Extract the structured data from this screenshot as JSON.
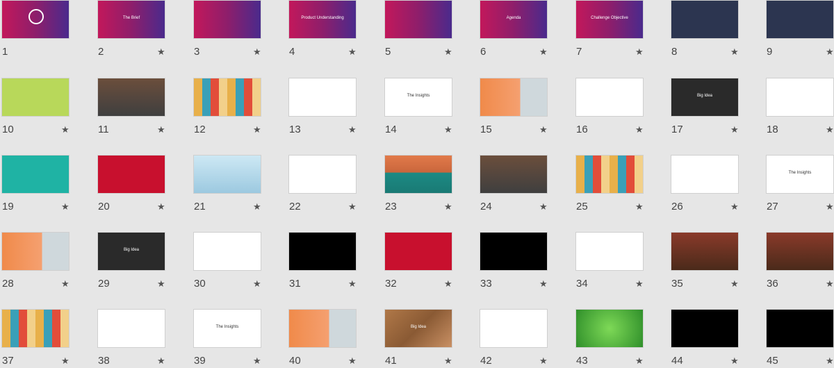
{
  "star_glyph": "★",
  "slides": [
    {
      "number": "1",
      "theme": "grad",
      "text": "",
      "starred": false
    },
    {
      "number": "2",
      "theme": "grad",
      "text": "The Brief",
      "starred": true
    },
    {
      "number": "3",
      "theme": "grad",
      "text": "",
      "starred": true
    },
    {
      "number": "4",
      "theme": "grad",
      "text": "Product Understanding",
      "starred": true
    },
    {
      "number": "5",
      "theme": "grad",
      "text": "",
      "starred": true
    },
    {
      "number": "6",
      "theme": "grad",
      "text": "Agenda",
      "starred": true
    },
    {
      "number": "7",
      "theme": "grad",
      "text": "Challenge     Objective",
      "starred": true
    },
    {
      "number": "8",
      "theme": "night",
      "text": "",
      "starred": true
    },
    {
      "number": "9",
      "theme": "night",
      "text": "",
      "starred": true
    },
    {
      "number": "10",
      "theme": "lime",
      "text": "",
      "starred": true
    },
    {
      "number": "11",
      "theme": "room",
      "text": "",
      "starred": true
    },
    {
      "number": "12",
      "theme": "pattern",
      "text": "",
      "starred": true
    },
    {
      "number": "13",
      "theme": "white",
      "text": "",
      "starred": true
    },
    {
      "number": "14",
      "theme": "white",
      "text": "The Insights",
      "starred": true
    },
    {
      "number": "15",
      "theme": "orange",
      "text": "",
      "starred": true
    },
    {
      "number": "16",
      "theme": "white",
      "text": "",
      "starred": true
    },
    {
      "number": "17",
      "theme": "dark",
      "text": "Big Idea",
      "starred": true
    },
    {
      "number": "18",
      "theme": "white",
      "text": "",
      "starred": true
    },
    {
      "number": "19",
      "theme": "teal",
      "text": "",
      "starred": true
    },
    {
      "number": "20",
      "theme": "red",
      "text": "",
      "starred": true
    },
    {
      "number": "21",
      "theme": "sky",
      "text": "",
      "starred": true
    },
    {
      "number": "22",
      "theme": "white",
      "text": "",
      "starred": true
    },
    {
      "number": "23",
      "theme": "kitchen",
      "text": "",
      "starred": true
    },
    {
      "number": "24",
      "theme": "room",
      "text": "",
      "starred": true
    },
    {
      "number": "25",
      "theme": "pattern",
      "text": "",
      "starred": true
    },
    {
      "number": "26",
      "theme": "white",
      "text": "",
      "starred": true
    },
    {
      "number": "27",
      "theme": "white",
      "text": "The Insights",
      "starred": true
    },
    {
      "number": "28",
      "theme": "orange",
      "text": "",
      "starred": true
    },
    {
      "number": "29",
      "theme": "dark",
      "text": "Big Idea",
      "starred": true
    },
    {
      "number": "30",
      "theme": "white",
      "text": "",
      "starred": true
    },
    {
      "number": "31",
      "theme": "black",
      "text": "",
      "starred": true
    },
    {
      "number": "32",
      "theme": "red",
      "text": "",
      "starred": true
    },
    {
      "number": "33",
      "theme": "black",
      "text": "",
      "starred": true
    },
    {
      "number": "34",
      "theme": "white",
      "text": "",
      "starred": true
    },
    {
      "number": "35",
      "theme": "brown",
      "text": "",
      "starred": true
    },
    {
      "number": "36",
      "theme": "brown",
      "text": "",
      "starred": true
    },
    {
      "number": "37",
      "theme": "pattern",
      "text": "",
      "starred": true
    },
    {
      "number": "38",
      "theme": "white",
      "text": "",
      "starred": true
    },
    {
      "number": "39",
      "theme": "white",
      "text": "The Insights",
      "starred": true
    },
    {
      "number": "40",
      "theme": "orange",
      "text": "",
      "starred": true
    },
    {
      "number": "41",
      "theme": "hair",
      "text": "Big Idea",
      "starred": true
    },
    {
      "number": "42",
      "theme": "white",
      "text": "",
      "starred": true
    },
    {
      "number": "43",
      "theme": "green",
      "text": "",
      "starred": true
    },
    {
      "number": "44",
      "theme": "black",
      "text": "",
      "starred": true
    },
    {
      "number": "45",
      "theme": "black",
      "text": "",
      "starred": true
    }
  ]
}
